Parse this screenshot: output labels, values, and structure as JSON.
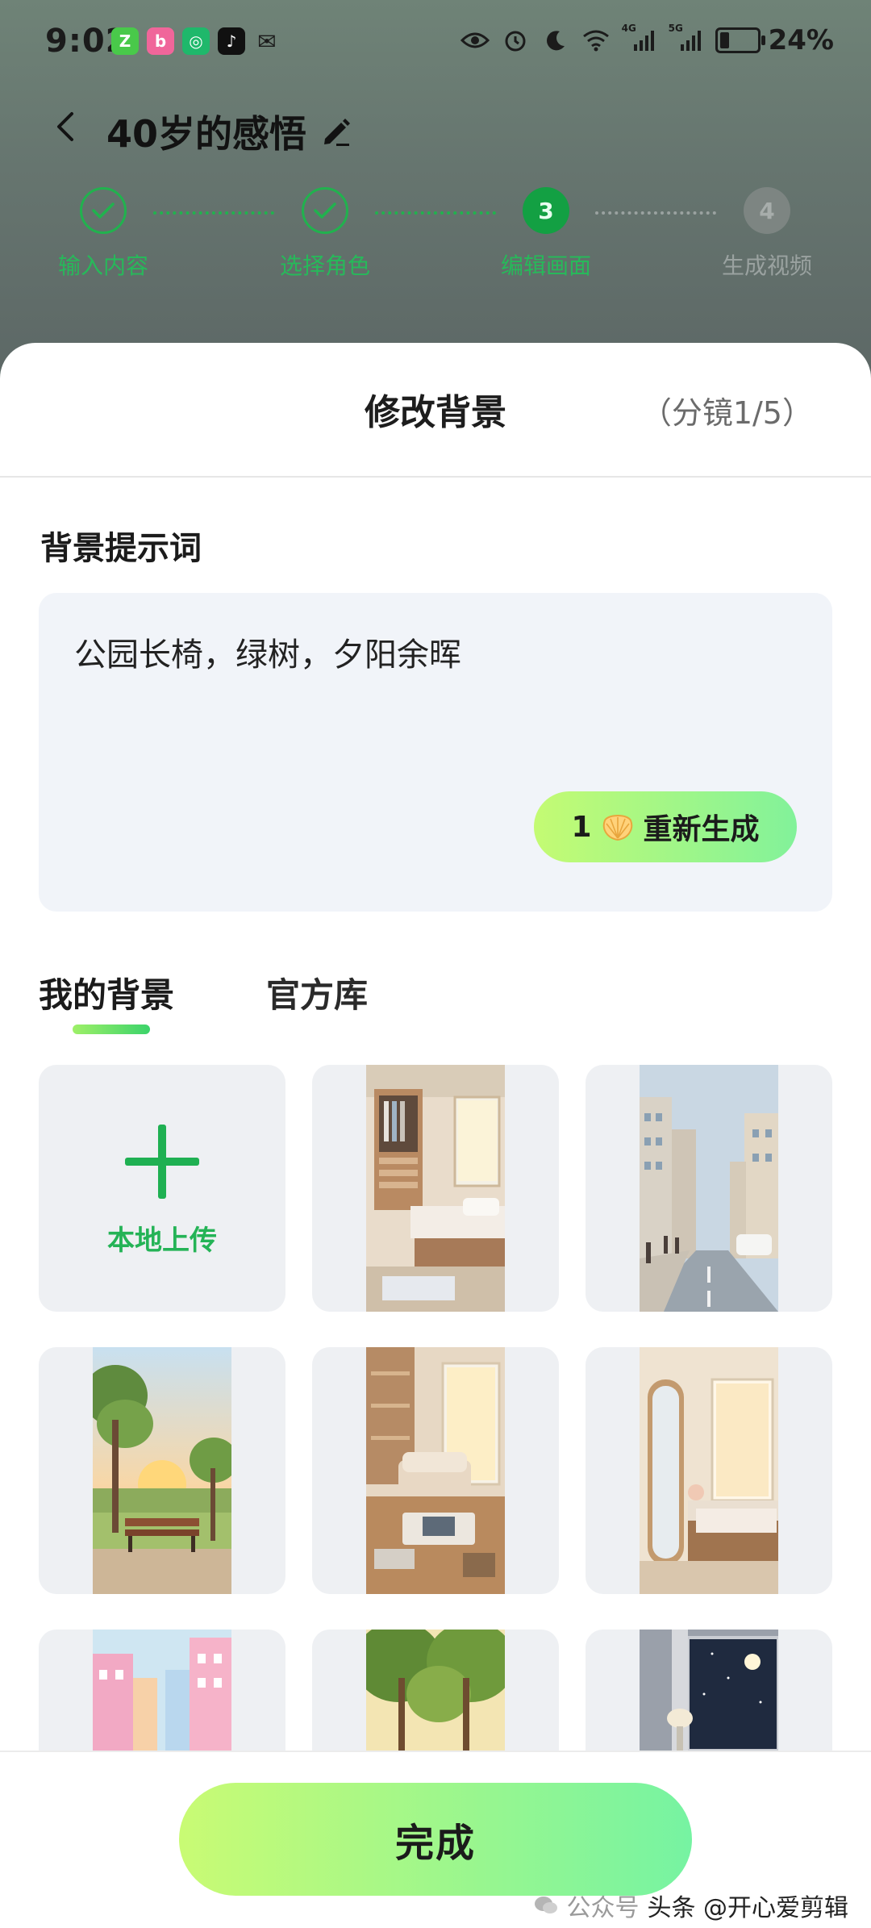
{
  "status_bar": {
    "time": "9:02",
    "battery_text": "24%",
    "battery_level": 0.24,
    "app_icons": [
      "zhihu-icon",
      "bilibili-icon",
      "green-app-icon",
      "tiktok-icon",
      "wechat-icon"
    ],
    "system_icons": [
      "eye-icon",
      "alarm-icon",
      "moon-icon",
      "wifi-icon",
      "signal-4g-icon",
      "signal-5g-icon",
      "battery-icon"
    ],
    "signal_labels": [
      "4G",
      "5G"
    ]
  },
  "header": {
    "title": "40岁的感悟"
  },
  "stepper": {
    "steps": [
      {
        "label": "输入内容",
        "state": "done",
        "number": "1"
      },
      {
        "label": "选择角色",
        "state": "done",
        "number": "2"
      },
      {
        "label": "编辑画面",
        "state": "active",
        "number": "3"
      },
      {
        "label": "生成视频",
        "state": "todo",
        "number": "4"
      }
    ]
  },
  "sheet": {
    "title": "修改背景",
    "subtitle": "（分镜1/5）",
    "prompt_section_label": "背景提示词",
    "prompt_text": "公园长椅，绿树，夕阳余晖",
    "regenerate": {
      "count": "1",
      "label": "重新生成"
    },
    "tabs": [
      {
        "label": "我的背景",
        "active": true
      },
      {
        "label": "官方库",
        "active": false
      }
    ],
    "upload_label": "本地上传",
    "backgrounds": [
      {
        "scene": "bedroom-warm"
      },
      {
        "scene": "city-street"
      },
      {
        "scene": "park-sunset-bench"
      },
      {
        "scene": "living-room"
      },
      {
        "scene": "bedroom-mirror"
      },
      {
        "scene": "pink-street"
      },
      {
        "scene": "green-trees"
      },
      {
        "scene": "night-window-room"
      }
    ]
  },
  "footer": {
    "done_label": "完成",
    "watermark_left": "公众号",
    "watermark_text": "头条 @开心爱剪辑"
  },
  "colors": {
    "accent_green": "#21b24e",
    "gradient_start": "#c9fb74",
    "gradient_end": "#76f3a2",
    "sheet_bg": "#ffffff",
    "input_bg": "#f1f4f9"
  }
}
